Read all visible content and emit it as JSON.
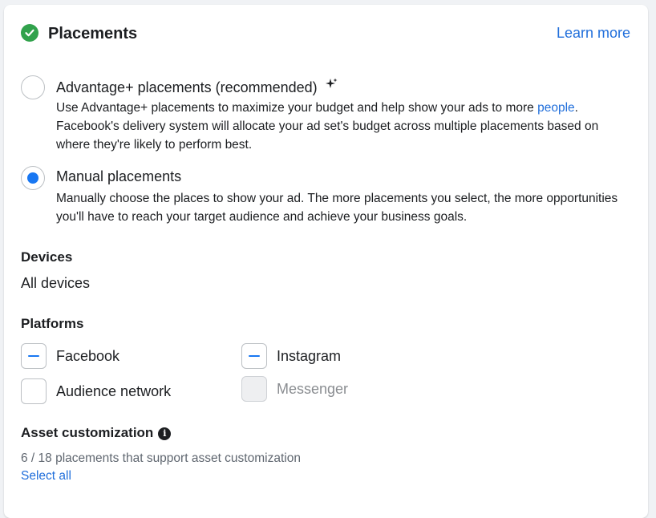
{
  "section": {
    "title": "Placements",
    "learn_more": "Learn more",
    "status_icon": "check-circle-icon",
    "status_color": "#31a24c"
  },
  "options": {
    "advantage": {
      "label": "Advantage+ placements (recommended)",
      "desc_before_link": "Use Advantage+ placements to maximize your budget and help show your ads to more ",
      "link": "people",
      "desc_after_link": ". Facebook's delivery system will allocate your ad set's budget across multiple placements based on where they're likely to perform best.",
      "selected": false,
      "icon": "sparkle-icon"
    },
    "manual": {
      "label": "Manual placements",
      "desc": "Manually choose the places to show your ad. The more placements you select, the more opportunities you'll have to reach your target audience and achieve your business goals.",
      "selected": true
    }
  },
  "devices": {
    "label": "Devices",
    "value": "All devices"
  },
  "platforms": {
    "label": "Platforms",
    "items": {
      "facebook": {
        "label": "Facebook",
        "state": "indeterminate"
      },
      "instagram": {
        "label": "Instagram",
        "state": "indeterminate"
      },
      "audience_network": {
        "label": "Audience network",
        "state": "unchecked"
      },
      "messenger": {
        "label": "Messenger",
        "state": "disabled"
      }
    }
  },
  "asset_customization": {
    "label": "Asset customization",
    "info_icon": "info-icon",
    "summary": "6 / 18 placements that support asset customization",
    "select_all": "Select all"
  },
  "colors": {
    "accent": "#1877f2",
    "link": "#216fdb",
    "text": "#1c1e21",
    "muted": "#606770"
  }
}
